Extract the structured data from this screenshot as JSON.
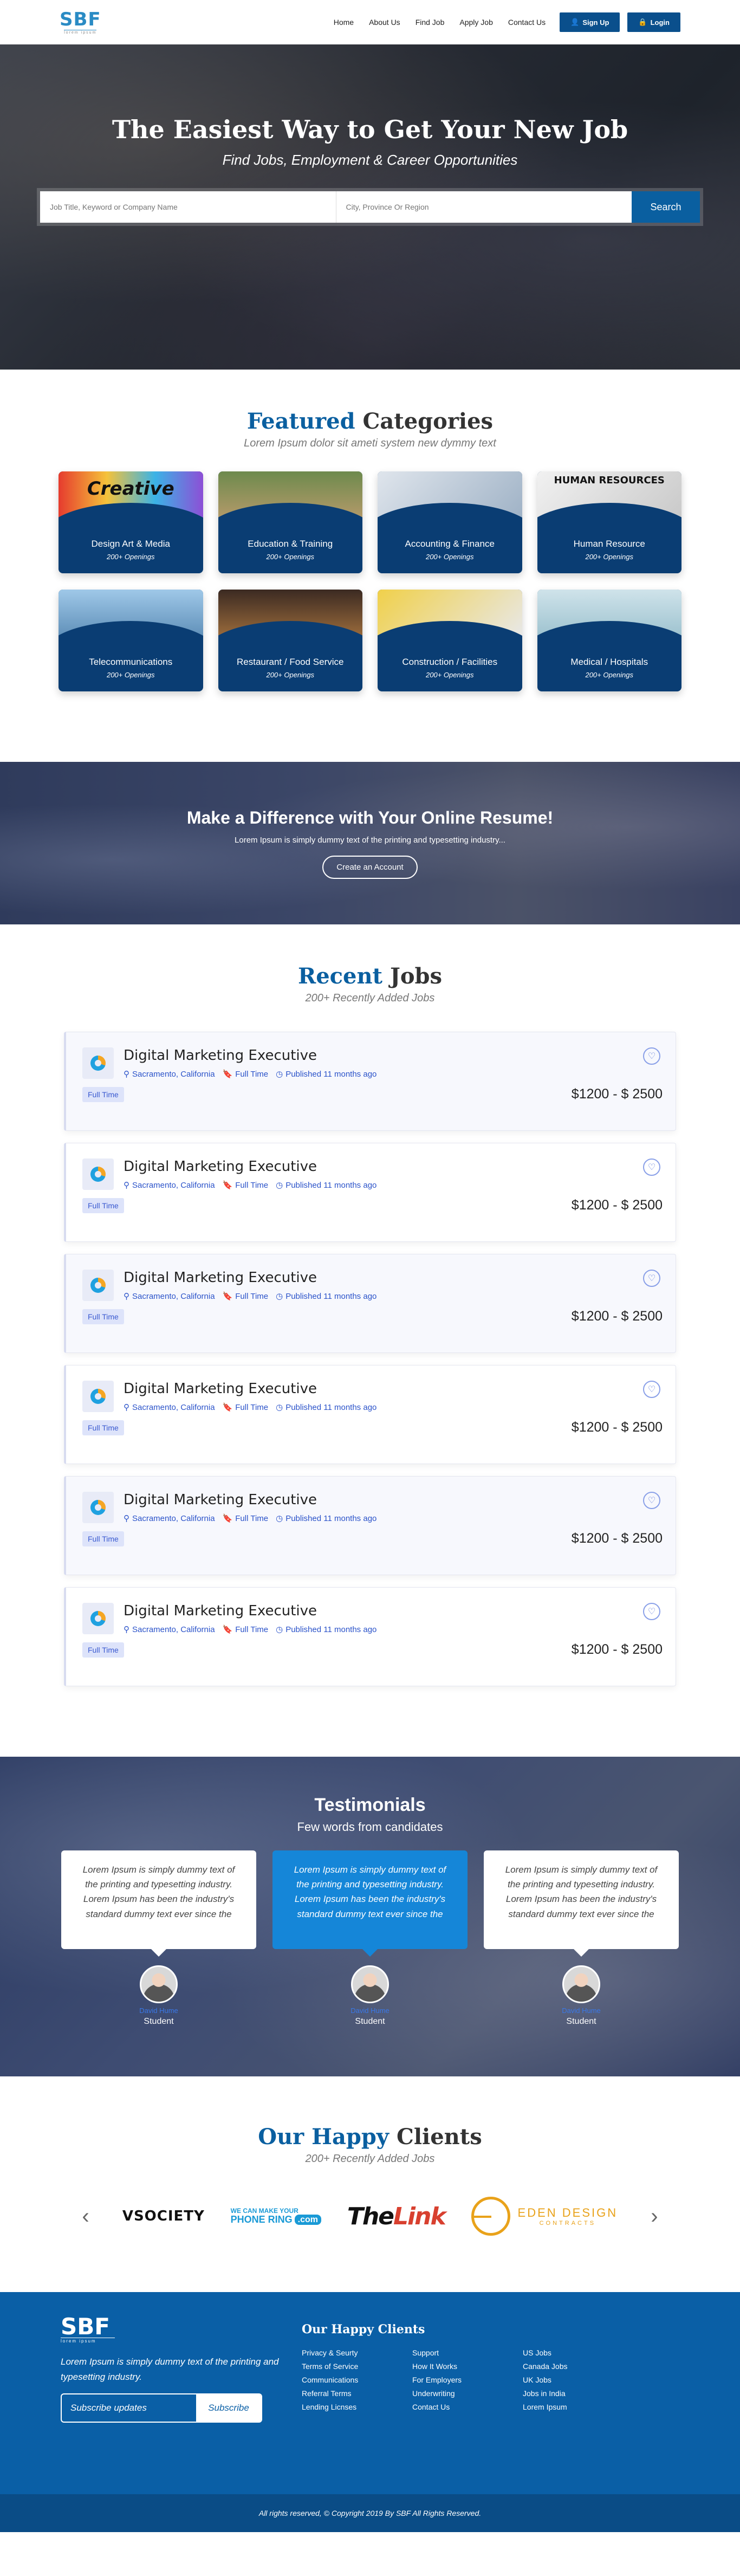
{
  "header": {
    "logo_text": "SBF",
    "logo_sub": "lorem ipsum",
    "nav": [
      "Home",
      "About Us",
      "Find Job",
      "Apply Job",
      "Contact Us"
    ],
    "signup_label": "Sign Up",
    "login_label": "Login"
  },
  "hero": {
    "title": "The Easiest Way to Get Your New Job",
    "subtitle": "Find Jobs, Employment & Career Opportunities",
    "keyword_placeholder": "Job Title, Keyword or Company Name",
    "location_placeholder": "City, Province Or Region",
    "search_label": "Search"
  },
  "categories": {
    "title_accent": "Featured",
    "title_rest": "Categories",
    "subtitle": "Lorem Ipsum dolor sit ameti system new dymmy text",
    "items": [
      {
        "name": "Design Art & Media",
        "openings": "200+ Openings"
      },
      {
        "name": "Education & Training",
        "openings": "200+ Openings"
      },
      {
        "name": "Accounting & Finance",
        "openings": "200+ Openings"
      },
      {
        "name": "Human Resource",
        "openings": "200+ Openings"
      },
      {
        "name": "Telecommunications",
        "openings": "200+ Openings"
      },
      {
        "name": "Restaurant / Food Service",
        "openings": "200+ Openings"
      },
      {
        "name": "Construction / Facilities",
        "openings": "200+ Openings"
      },
      {
        "name": "Medical / Hospitals",
        "openings": "200+ Openings"
      }
    ],
    "image_words": [
      "Creative",
      "",
      "",
      "HUMAN RESOURCES",
      "",
      "",
      "",
      ""
    ]
  },
  "resume": {
    "title": "Make a Difference with Your Online Resume!",
    "text": "Lorem Ipsum is simply dummy text of the printing and typesetting industry...",
    "button": "Create an Account"
  },
  "jobs": {
    "title_accent": "Recent",
    "title_rest": "Jobs",
    "subtitle": "200+ Recently Added Jobs",
    "items": [
      {
        "title": "Digital Marketing Executive",
        "location": "Sacramento, California",
        "type": "Full Time",
        "published": "Published 11 months ago",
        "badge": "Full Time",
        "salary": "$1200 - $ 2500"
      },
      {
        "title": "Digital Marketing Executive",
        "location": "Sacramento, California",
        "type": "Full Time",
        "published": "Published 11 months ago",
        "badge": "Full Time",
        "salary": "$1200 - $ 2500"
      },
      {
        "title": "Digital Marketing Executive",
        "location": "Sacramento, California",
        "type": "Full Time",
        "published": "Published 11 months ago",
        "badge": "Full Time",
        "salary": "$1200 - $ 2500"
      },
      {
        "title": "Digital Marketing Executive",
        "location": "Sacramento, California",
        "type": "Full Time",
        "published": "Published 11 months ago",
        "badge": "Full Time",
        "salary": "$1200 - $ 2500"
      },
      {
        "title": "Digital Marketing Executive",
        "location": "Sacramento, California",
        "type": "Full Time",
        "published": "Published 11 months ago",
        "badge": "Full Time",
        "salary": "$1200 - $ 2500"
      },
      {
        "title": "Digital Marketing Executive",
        "location": "Sacramento, California",
        "type": "Full Time",
        "published": "Published 11 months ago",
        "badge": "Full Time",
        "salary": "$1200 - $ 2500"
      }
    ]
  },
  "testimonials": {
    "title": "Testimonials",
    "subtitle": "Few words from candidates",
    "items": [
      {
        "text": "Lorem Ipsum is simply dummy text of the printing and typesetting industry. Lorem Ipsum has been the industry's standard dummy text ever since the",
        "name": "David Hume",
        "role": "Student"
      },
      {
        "text": "Lorem Ipsum is simply dummy text of the printing and typesetting industry. Lorem Ipsum has been the industry's standard dummy text ever since the",
        "name": "David Hume",
        "role": "Student"
      },
      {
        "text": "Lorem Ipsum is simply dummy text of the printing and typesetting industry. Lorem Ipsum has been the industry's standard dummy text ever since the",
        "name": "David Hume",
        "role": "Student"
      }
    ]
  },
  "clients": {
    "title_accent": "Our Happy",
    "title_rest": "Clients",
    "subtitle": "200+ Recently Added Jobs",
    "logos": {
      "society": "SOCIETY",
      "phone_small": "WE CAN MAKE YOUR",
      "phone_big": "PHONE RING",
      "phone_com": ".com",
      "link_the": "The",
      "link_link": "Link",
      "eden": "EDEN DESIGN",
      "eden_sub": "CONTRACTS"
    },
    "prev": "‹",
    "next": "›"
  },
  "footer": {
    "logo_text": "SBF",
    "logo_sub": "lorem ipsum",
    "desc": "Lorem Ipsum is simply dummy text of the printing and typesetting industry.",
    "subscribe_placeholder": "Subscribe updates",
    "subscribe_button": "Subscribe",
    "links_title": "Our Happy Clients",
    "col1": [
      "Privacy & Seurty",
      "Terms of Service",
      "Communications",
      "Referral Terms",
      "Lending Licnses"
    ],
    "col2": [
      "Support",
      "How It Works",
      "For Employers",
      "Underwriting",
      "Contact Us"
    ],
    "col3": [
      "US Jobs",
      "Canada Jobs",
      "UK Jobs",
      "Jobs in India",
      "Lorem Ipsum"
    ],
    "copyright": "All rights reserved, © Copyright 2019 By  SBF All Rights Reserved."
  },
  "colors": {
    "brand": "#0a5fa0",
    "navy": "#0a3d73",
    "footer": "#0a5fa6"
  }
}
